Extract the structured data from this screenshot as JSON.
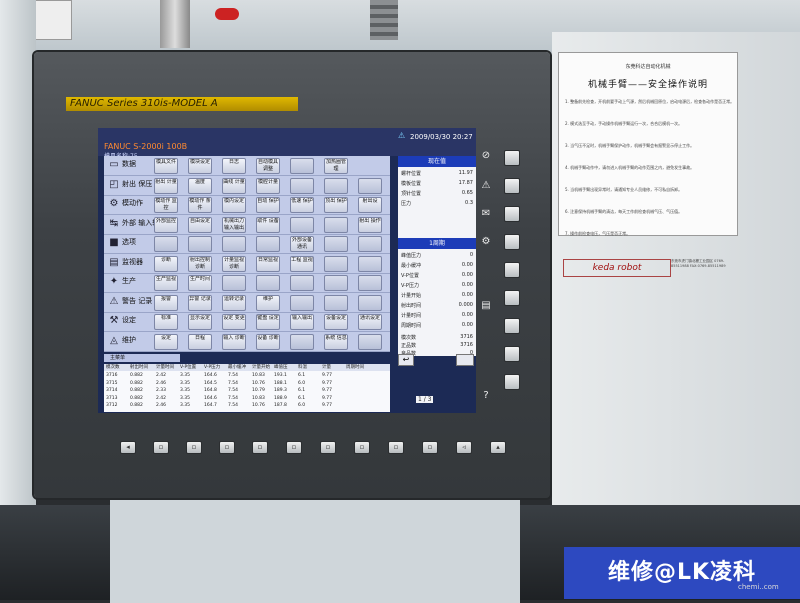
{
  "bezel": {
    "brand": "FANUC Series 310is-MODEL A"
  },
  "screen": {
    "alarm": "FANUC S-2000i 100B",
    "mold": "模具名称:75",
    "datetime": "2009/03/30 20:27",
    "menu": [
      {
        "icon": "▭",
        "label": "数据",
        "buttons": [
          "模具文件",
          "模块设定",
          "日志",
          "自动模具调整",
          "",
          "加热圈管理"
        ]
      },
      {
        "icon": "◰",
        "label": "射出\n保压",
        "buttons": [
          "射出\n计量",
          "温度",
          "曲线\n计量",
          "模腔计量",
          "",
          "",
          ""
        ]
      },
      {
        "icon": "⚙",
        "label": "模动作",
        "buttons": [
          "模动作\n监控",
          "模动作\n条件",
          "模内设定",
          "自动\n保护",
          "低速\n保护",
          "顶出\n保护",
          "射出设"
        ]
      },
      {
        "icon": "↹",
        "label": "外部\n输入输出",
        "buttons": [
          "外部监控",
          "自由设定",
          "机械出力\n输入输出",
          "取件\n设备",
          "",
          "",
          "射出\n操作"
        ]
      },
      {
        "icon": "■",
        "label": "选项",
        "buttons": [
          "",
          "",
          "",
          "",
          "外部设备\n通讯",
          "",
          ""
        ]
      },
      {
        "icon": "▤",
        "label": "监视器",
        "buttons": [
          "诊断",
          "射出控制\n诊断",
          "计量监视\n诊断",
          "日常监视",
          "工程\n监视",
          "",
          ""
        ]
      },
      {
        "icon": "✦",
        "label": "生产",
        "buttons": [
          "生产监视",
          "生产时间",
          "",
          "",
          "",
          "",
          ""
        ]
      },
      {
        "icon": "⚠",
        "label": "警告\n记录",
        "buttons": [
          "报警",
          "异警\n记录",
          "运转记录",
          "维护",
          "",
          "",
          ""
        ]
      },
      {
        "icon": "⚒",
        "label": "设定",
        "buttons": [
          "标准",
          "显示设定",
          "设定\n变更",
          "键盘\n设定",
          "输入输出",
          "设备设定",
          "通讯设定"
        ]
      },
      {
        "icon": "◬",
        "label": "维护",
        "buttons": [
          "设定",
          "日程",
          "输入\n诊断",
          "设备\n诊断",
          "",
          "系统\n信息",
          ""
        ]
      }
    ],
    "tab": "主菜单",
    "status": {
      "title": "现在值",
      "rows": [
        {
          "label": "螺杆位置",
          "value": "11.97"
        },
        {
          "label": "模板位置",
          "value": "17.87"
        },
        {
          "label": "顶针位置",
          "value": "0.65"
        },
        {
          "label": "压力",
          "value": "0.3"
        }
      ],
      "section2_title": "1周期",
      "rows2": [
        {
          "label": "峰值压力",
          "value": "0"
        },
        {
          "label": "最小缓冲",
          "value": "0.00"
        },
        {
          "label": "V-P位置",
          "value": "0.00"
        },
        {
          "label": "V-P压力",
          "value": "0.00"
        },
        {
          "label": "计量开始",
          "value": "0.00"
        },
        {
          "label": "射出时间",
          "value": "0.000"
        },
        {
          "label": "计量时间",
          "value": "0.00"
        },
        {
          "label": "周期时间",
          "value": "0.00"
        }
      ],
      "rows3": [
        {
          "label": "模次数",
          "value": "3716"
        },
        {
          "label": "正品数",
          "value": "3716"
        },
        {
          "label": "良品数",
          "value": "0"
        }
      ]
    },
    "table": {
      "headers": [
        "模次数",
        "射出时间",
        "计量时间",
        "V-P位置",
        "V-P压力",
        "最小缓冲",
        "计量开始",
        "峰值压",
        "料温",
        "计量",
        "周期时间"
      ],
      "rows": [
        [
          "3716",
          "0.882",
          "2.42",
          "3.35",
          "164.6",
          "7.54",
          "10.83",
          "193.1",
          "6.1",
          "9.77"
        ],
        [
          "3715",
          "0.882",
          "2.46",
          "3.35",
          "164.5",
          "7.54",
          "10.76",
          "188.1",
          "6.0",
          "9.77"
        ],
        [
          "3714",
          "0.882",
          "2.33",
          "3.35",
          "164.8",
          "7.54",
          "10.79",
          "189.3",
          "6.1",
          "9.77"
        ],
        [
          "3713",
          "0.882",
          "2.42",
          "3.35",
          "164.6",
          "7.54",
          "10.83",
          "188.9",
          "6.1",
          "9.77"
        ],
        [
          "3712",
          "0.882",
          "2.46",
          "3.35",
          "164.7",
          "7.54",
          "10.76",
          "187.8",
          "6.0",
          "9.77"
        ]
      ],
      "page": "1 / 3"
    }
  },
  "sign": {
    "org": "东莞科达自动化机械",
    "title": "机械手臂——安全操作说明",
    "lines": [
      "1. 整备前先检查，开机前要手动上气源，然后机械回原位，启动电源后，检查各动作是否正常。",
      "2. 模式选至手动，手动操作机械手臂运行一次，合合后模机一次。",
      "3. 当气压不足时，机械手臂保护动作，机械手臂会有报警显示停止工作。",
      "4. 机械手臂动作中，请勿进入机械手臂的动作范围之内，避免发生事故。",
      "5. 当机械手臂出现异常时，请通知专业人员维修，不可私自拆卸。",
      "6. 注意保持机械手臂的清洁，每天工作前检查机械气压、气压值。",
      "7. 操作前检查电压，气压是否正常。"
    ],
    "logo": "keda robot",
    "addr": "东莞市虎门镇北栅工业园区 0769-85511988 FAX:0769-85511989"
  },
  "watermark": {
    "text": "维修@LK凌科",
    "url": "chemi..com"
  }
}
